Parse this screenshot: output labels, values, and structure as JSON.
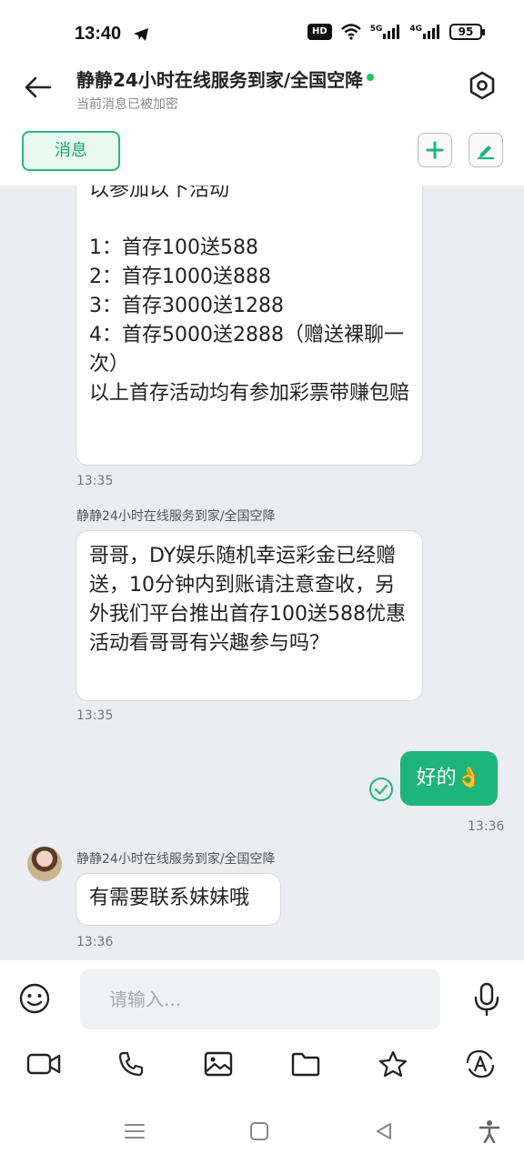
{
  "status": {
    "time": "13:40",
    "hd": "HD",
    "net5g": "5G",
    "net4g": "4G",
    "battery": "95"
  },
  "header": {
    "title": "静静24小时在线服务到家/全国空降",
    "subtitle": "当前消息已被加密",
    "tab_label": "消息"
  },
  "messages": [
    {
      "text": "以参加以下活动\n\n1：首存100送588\n2：首存1000送888\n3：首存3000送1288\n4：首存5000送2888（赠送裸聊一次）\n以上首存活动均有参加彩票带赚包赔",
      "time": "13:35"
    },
    {
      "sender": "静静24小时在线服务到家/全国空降",
      "text": "哥哥，DY娱乐随机幸运彩金已经赠送，10分钟内到账请注意查收，另外我们平台推出首存100送588优惠活动看哥哥有兴趣参与吗？",
      "time": "13:35"
    },
    {
      "text": "好的👌",
      "time": "13:36"
    },
    {
      "sender": "静静24小时在线服务到家/全国空降",
      "text": "有需要联系妹妹哦",
      "time": "13:36"
    }
  ],
  "input": {
    "placeholder": "请输入..."
  },
  "colors": {
    "accent": "#1eb57a",
    "online": "#22c55e"
  }
}
